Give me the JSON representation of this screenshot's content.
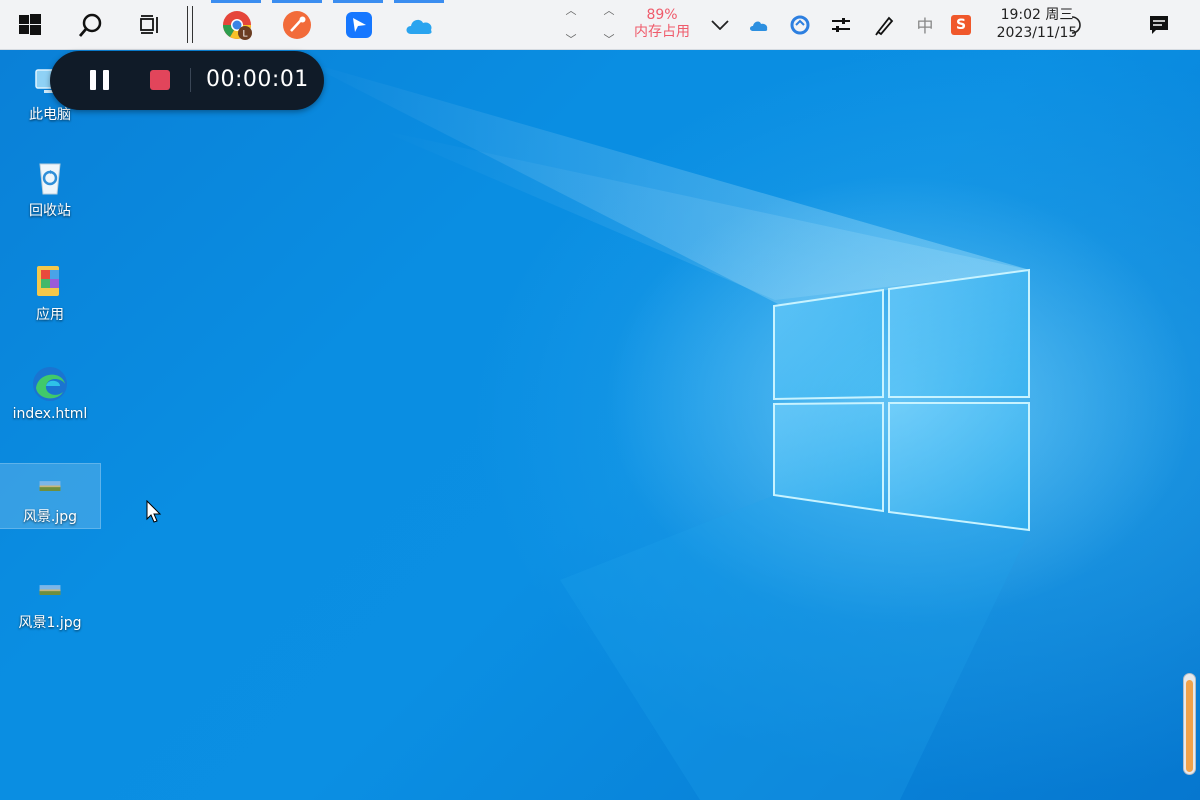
{
  "taskbar": {
    "apps": [
      {
        "name": "Chrome",
        "icon": "chrome-icon"
      },
      {
        "name": "Postman",
        "icon": "postman-icon"
      },
      {
        "name": "Feishu",
        "icon": "feishu-icon"
      },
      {
        "name": "OneDrive",
        "icon": "cloud-icon"
      }
    ],
    "memory_percent": "89%",
    "memory_label": "内存占用",
    "ime_label": "中",
    "sogou_label": "S",
    "time": "19:02 周三",
    "date": "2023/11/15",
    "chrome_badge": "L"
  },
  "recorder": {
    "elapsed": "00:00:01"
  },
  "desktop_icons": [
    {
      "label": "此电脑",
      "icon": "computer-icon"
    },
    {
      "label": "回收站",
      "icon": "recycle-bin-icon"
    },
    {
      "label": "应用",
      "icon": "apps-folder-icon"
    },
    {
      "label": "index.html",
      "icon": "edge-icon"
    },
    {
      "label": "风景.jpg",
      "icon": "image-file-icon"
    },
    {
      "label": "风景1.jpg",
      "icon": "image-file-icon"
    }
  ],
  "side_scroll": {
    "fill_fraction": 0.92
  },
  "colors": {
    "accent": "#3b8df0",
    "memory_warn": "#ef5b6b",
    "recorder_bg": "#101b28",
    "stop": "#e2455b"
  }
}
